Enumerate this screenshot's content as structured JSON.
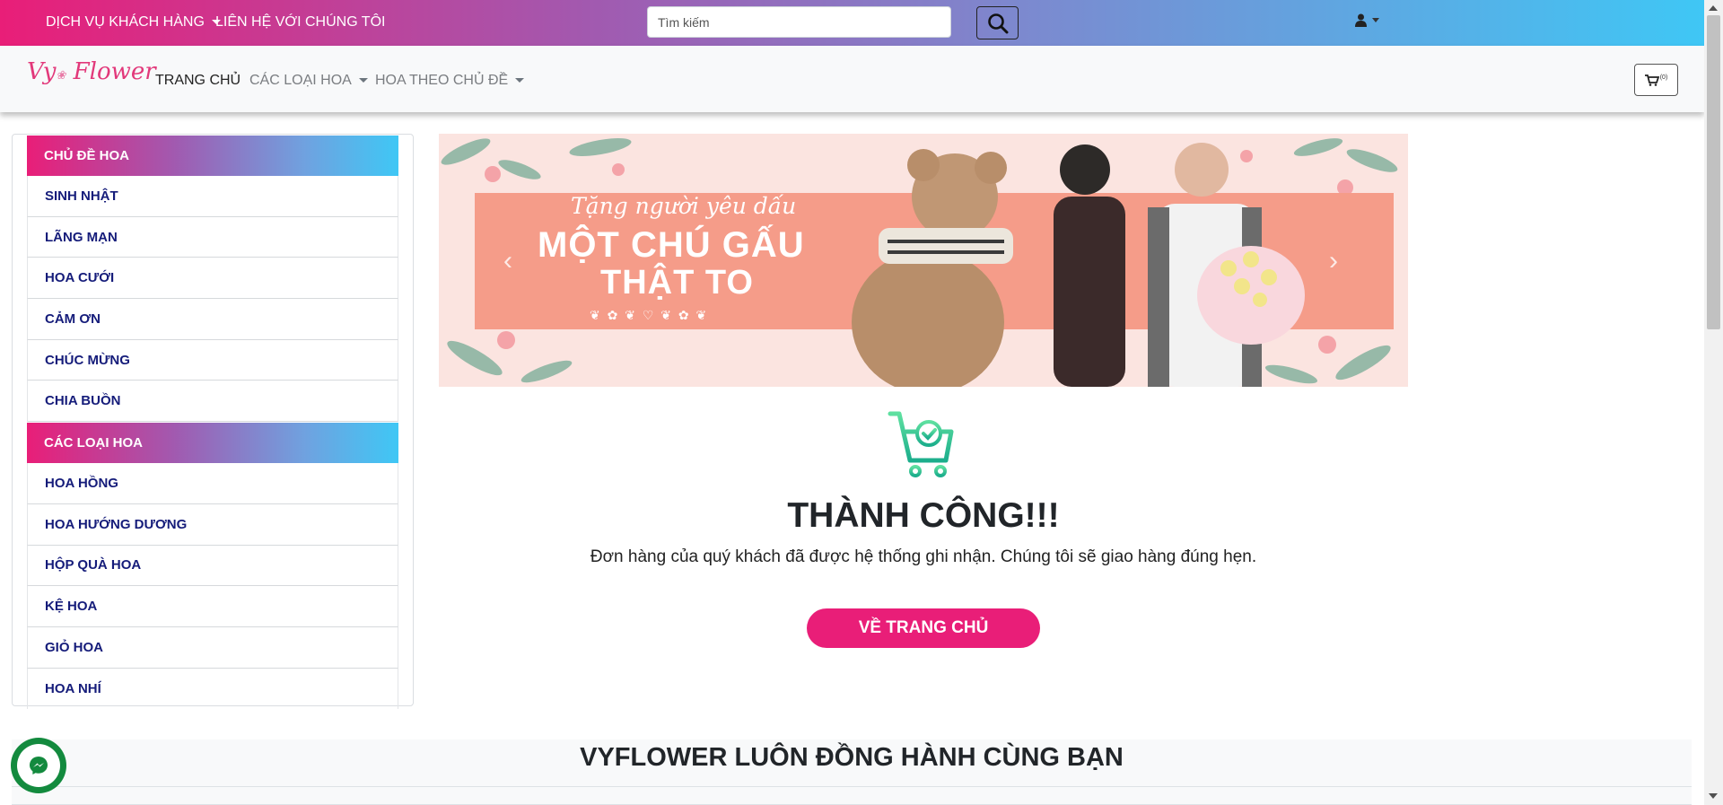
{
  "topbar": {
    "customer_service": "DỊCH VỤ KHÁCH HÀNG",
    "contact": "LIÊN HỆ VỚI CHÚNG TÔI",
    "search_placeholder": "Tìm kiếm",
    "search_icon": "search-icon",
    "user_icon": "user-icon"
  },
  "navbar": {
    "logo_vy": "Vy",
    "logo_flower": "Flower",
    "home": "TRANG CHỦ",
    "flower_types": "CÁC LOẠI HOA",
    "flower_topics": "HOA THEO CHỦ ĐỀ",
    "cart_count": "(0)",
    "cart_icon": "cart-icon"
  },
  "sidebar": {
    "topic_header": "CHỦ ĐỀ HOA",
    "topics": [
      "SINH NHẬT",
      "LÃNG MẠN",
      "HOA CƯỚI",
      "CẢM ƠN",
      "CHÚC MỪNG",
      "CHIA BUỒN"
    ],
    "types_header": "CÁC LOẠI HOA",
    "types": [
      "HOA HỒNG",
      "HOA HƯỚNG DƯƠNG",
      "HỘP QUÀ HOA",
      "KỆ HOA",
      "GIỎ HOA",
      "HOA NHÍ"
    ]
  },
  "banner": {
    "line1": "Tặng người yêu dấu",
    "line2": "MỘT CHÚ GẤU",
    "line3": "THẬT TO"
  },
  "success": {
    "icon": "cart-check-icon",
    "title": "THÀNH CÔNG!!!",
    "message": "Đơn hàng của quý khách đã được hệ thống ghi nhận. Chúng tôi sẽ giao hàng đúng hẹn.",
    "home_button": "VỀ TRANG CHỦ"
  },
  "bottom": {
    "title": "VYFLOWER LUÔN ĐỒNG HÀNH CÙNG BẠN"
  },
  "colors": {
    "brand_pink": "#e91e78",
    "brand_cyan": "#3fc7f5",
    "sidebar_text": "#151c7a",
    "success_green": "#3ecf8e"
  }
}
